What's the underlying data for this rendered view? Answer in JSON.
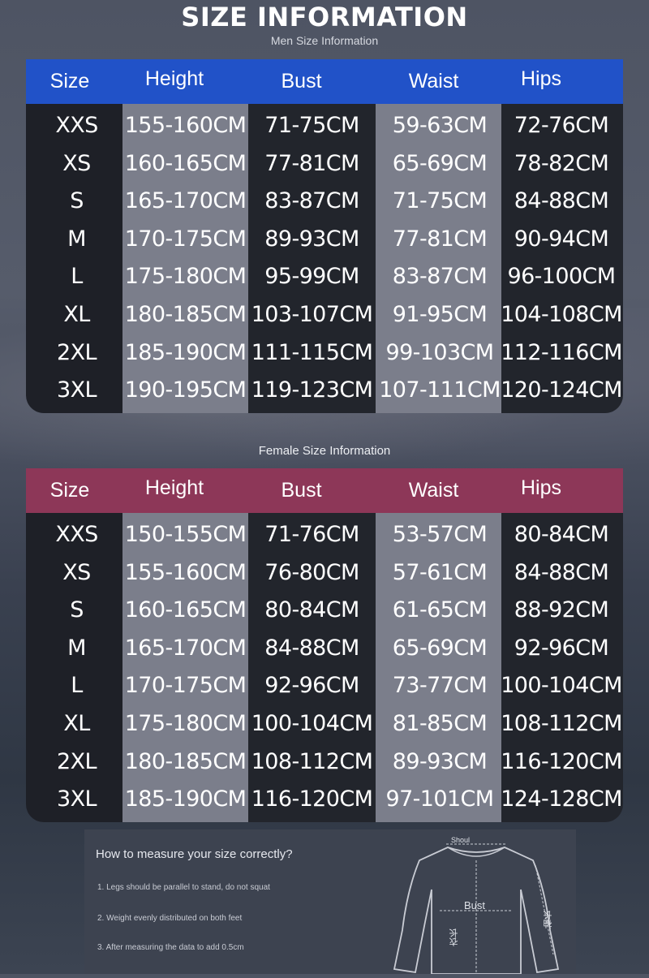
{
  "title": "SIZE INFORMATION",
  "men_subtitle": "Men Size Information",
  "female_subtitle": "Female Size Information",
  "headers": [
    "Size",
    "Height",
    "Bust",
    "Waist",
    "Hips"
  ],
  "colors": {
    "men_header": "#2152c8",
    "female_header": "#8d3758"
  },
  "men_rows": [
    [
      "XXS",
      "155-160CM",
      "71-75CM",
      "59-63CM",
      "72-76CM"
    ],
    [
      "XS",
      "160-165CM",
      "77-81CM",
      "65-69CM",
      "78-82CM"
    ],
    [
      "S",
      "165-170CM",
      "83-87CM",
      "71-75CM",
      "84-88CM"
    ],
    [
      "M",
      "170-175CM",
      "89-93CM",
      "77-81CM",
      "90-94CM"
    ],
    [
      "L",
      "175-180CM",
      "95-99CM",
      "83-87CM",
      "96-100CM"
    ],
    [
      "XL",
      "180-185CM",
      "103-107CM",
      "91-95CM",
      "104-108CM"
    ],
    [
      "2XL",
      "185-190CM",
      "111-115CM",
      "99-103CM",
      "112-116CM"
    ],
    [
      "3XL",
      "190-195CM",
      "119-123CM",
      "107-111CM",
      "120-124CM"
    ]
  ],
  "female_rows": [
    [
      "XXS",
      "150-155CM",
      "71-76CM",
      "53-57CM",
      "80-84CM"
    ],
    [
      "XS",
      "155-160CM",
      "76-80CM",
      "57-61CM",
      "84-88CM"
    ],
    [
      "S",
      "160-165CM",
      "80-84CM",
      "61-65CM",
      "88-92CM"
    ],
    [
      "M",
      "165-170CM",
      "84-88CM",
      "65-69CM",
      "92-96CM"
    ],
    [
      "L",
      "170-175CM",
      "92-96CM",
      "73-77CM",
      "100-104CM"
    ],
    [
      "XL",
      "175-180CM",
      "100-104CM",
      "81-85CM",
      "108-112CM"
    ],
    [
      "2XL",
      "180-185CM",
      "108-112CM",
      "89-93CM",
      "116-120CM"
    ],
    [
      "3XL",
      "185-190CM",
      "116-120CM",
      "97-101CM",
      "124-128CM"
    ]
  ],
  "measure": {
    "title": "How to measure your size correctly?",
    "steps": [
      "1. Legs should be parallel to stand, do not squat",
      "2. Weight evenly distributed on both feet",
      "3. After measuring the data to add 0.5cm"
    ],
    "diagram_labels": {
      "shoulder": "Shoul",
      "bust": "Bust",
      "length": "衣长",
      "sleeve": "袖长"
    }
  }
}
